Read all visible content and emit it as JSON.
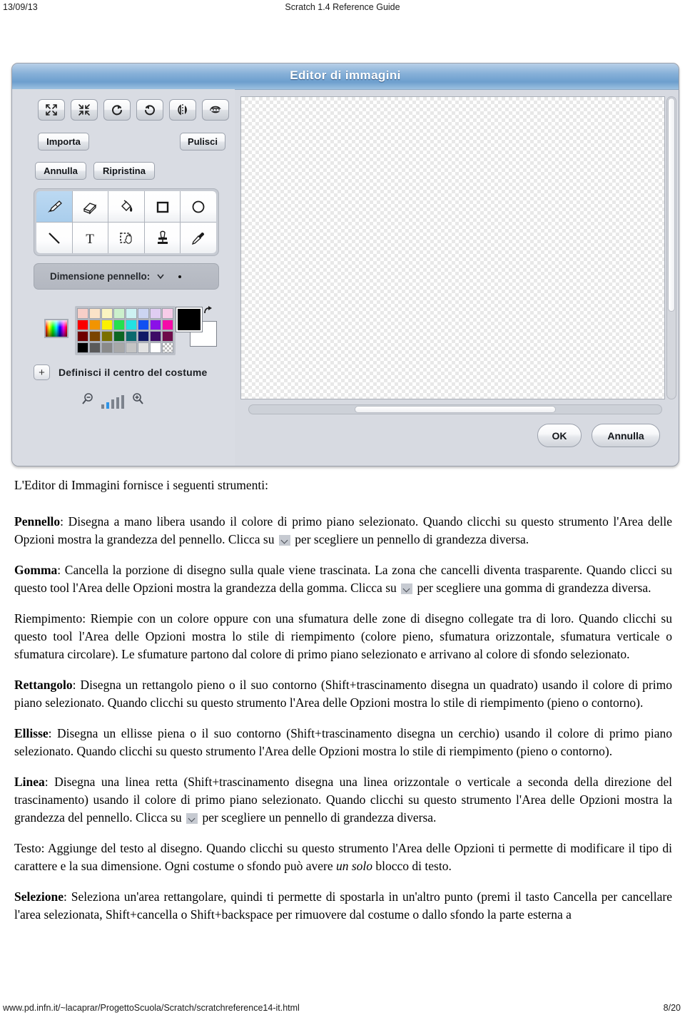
{
  "page_header": {
    "date": "13/09/13",
    "title": "Scratch 1.4 Reference Guide"
  },
  "page_footer": {
    "url": "www.pd.infn.it/~lacaprar/ProgettoScuola/Scratch/scratchreference14-it.html",
    "page_number": "8/20"
  },
  "editor": {
    "title": "Editor di immagini",
    "transform_buttons": [
      {
        "name": "grow-icon",
        "tooltip": "Ingrandisci"
      },
      {
        "name": "shrink-icon",
        "tooltip": "Rimpicciolisci"
      },
      {
        "name": "rotate-cw-icon",
        "tooltip": "Ruota a destra"
      },
      {
        "name": "rotate-ccw-icon",
        "tooltip": "Ruota a sinistra"
      },
      {
        "name": "flip-horizontal-icon",
        "tooltip": "Rifletti orizzontalmente"
      },
      {
        "name": "flip-vertical-icon",
        "tooltip": "Rifletti verticalmente"
      }
    ],
    "buttons": {
      "import": "Importa",
      "clear": "Pulisci",
      "undo": "Annulla",
      "redo": "Ripristina",
      "ok": "OK",
      "cancel": "Annulla"
    },
    "tools": [
      {
        "name": "brush-tool",
        "label": "Pennello",
        "selected": true
      },
      {
        "name": "eraser-tool",
        "label": "Gomma",
        "selected": false
      },
      {
        "name": "fill-tool",
        "label": "Riempimento",
        "selected": false
      },
      {
        "name": "rectangle-tool",
        "label": "Rettangolo",
        "selected": false
      },
      {
        "name": "ellipse-tool",
        "label": "Ellisse",
        "selected": false
      },
      {
        "name": "line-tool",
        "label": "Linea",
        "selected": false
      },
      {
        "name": "text-tool",
        "label": "Testo",
        "selected": false
      },
      {
        "name": "select-tool",
        "label": "Selezione",
        "selected": false
      },
      {
        "name": "stamp-tool",
        "label": "Timbro",
        "selected": false
      },
      {
        "name": "eyedropper-tool",
        "label": "Contagocce",
        "selected": false
      }
    ],
    "brush_size": {
      "label": "Dimensione pennello:"
    },
    "colors": {
      "foreground": "#000000",
      "background": "#ffffff",
      "palette": [
        [
          "#f7cfc8",
          "#fae3c8",
          "#faf4c1",
          "#ccf0cc",
          "#cdf1f2",
          "#ccd5f2",
          "#e0cdf2",
          "#f7cce8"
        ],
        [
          "#fa0000",
          "#f29400",
          "#fbf000",
          "#25e04e",
          "#22e2e2",
          "#1050f2",
          "#8a11e8",
          "#f50ba8"
        ],
        [
          "#6e0000",
          "#7a4400",
          "#7a7000",
          "#0c6623",
          "#0b6a6e",
          "#111a66",
          "#3d0b66",
          "#6e0b4a"
        ],
        [
          "#000000",
          "#5a5a5a",
          "#8a8a8a",
          "#a8a8a8",
          "#c4c4c4",
          "#e2e2e2",
          "#ffffff",
          "transparent"
        ]
      ]
    },
    "costume_center": {
      "label": "Definisci il centro del costume",
      "plus": "+"
    },
    "zoom": {
      "out_icon": "zoom-out-icon",
      "in_icon": "zoom-in-icon",
      "levels": 5,
      "active_level": 2
    }
  },
  "content": {
    "intro": "L'Editor di Immagini fornisce i seguenti strumenti:",
    "paragraphs": [
      {
        "term": "Pennello",
        "bold_term": true,
        "separator": ": ",
        "before_chevron": "Disegna a mano libera usando il colore di primo piano selezionato. Quando clicchi su questo strumento l'Area delle Opzioni mostra la grandezza del pennello. Clicca su ",
        "has_chevron": true,
        "after_chevron": " per scegliere un pennello di grandezza diversa."
      },
      {
        "term": "Gomma",
        "bold_term": true,
        "separator": ": ",
        "before_chevron": "Cancella la porzione di disegno sulla quale viene trascinata. La zona che cancelli diventa trasparente. Quando clicci su questo tool l'Area delle Opzioni mostra la grandezza della gomma. Clicca su ",
        "has_chevron": true,
        "after_chevron": " per scegliere una gomma di grandezza diversa."
      },
      {
        "term": "Riempimento",
        "bold_term": false,
        "separator": ": ",
        "before_chevron": "Riempie con un colore oppure con una sfumatura delle zone di disegno collegate tra di loro. Quando clicchi su questo tool l'Area delle Opzioni mostra lo stile di riempimento (colore pieno, sfumatura orizzontale, sfumatura verticale o sfumatura circolare). Le sfumature partono dal colore di primo piano selezionato e arrivano al colore di sfondo selezionato.",
        "has_chevron": false,
        "after_chevron": ""
      },
      {
        "term": "Rettangolo",
        "bold_term": true,
        "separator": ": ",
        "before_chevron": "Disegna un rettangolo pieno o il suo contorno (Shift+trascinamento disegna un quadrato) usando il colore di primo piano selezionato. Quando clicchi su questo strumento l'Area delle Opzioni mostra lo stile di riempimento (pieno o contorno).",
        "has_chevron": false,
        "after_chevron": ""
      },
      {
        "term": "Ellisse",
        "bold_term": true,
        "separator": ": ",
        "before_chevron": "Disegna un ellisse piena o il suo contorno (Shift+trascinamento disegna un cerchio) usando il colore di primo piano selezionato. Quando clicchi su questo strumento l'Area delle Opzioni mostra lo stile di riempimento (pieno o contorno).",
        "has_chevron": false,
        "after_chevron": ""
      },
      {
        "term": "Linea",
        "bold_term": true,
        "separator": ": ",
        "before_chevron": "Disegna una linea retta (Shift+trascinamento disegna una linea orizzontale o verticale a seconda della direzione del trascinamento) usando il colore di primo piano selezionato. Quando clicchi su questo strumento l'Area delle Opzioni mostra la grandezza del pennello. Clicca su ",
        "has_chevron": true,
        "after_chevron": " per scegliere un pennello di grandezza diversa."
      }
    ],
    "text_paragraph": {
      "term": "Testo",
      "separator": ": ",
      "part1": "Aggiunge del testo al disegno. Quando clicchi su questo strumento l'Area delle Opzioni ti permette di modificare il tipo di carattere e la sua dimensione. Ogni costume o sfondo può avere ",
      "italic": "un solo",
      "part2": " blocco di testo."
    },
    "selection_paragraph": {
      "term": "Selezione",
      "separator": ": ",
      "text": "Seleziona un'area rettangolare, quindi ti permette di spostarla in un'altro punto (premi il tasto Cancella per cancellare l'area selezionata, Shift+cancella o Shift+backspace per rimuovere dal costume o dallo sfondo la parte esterna a"
    }
  }
}
